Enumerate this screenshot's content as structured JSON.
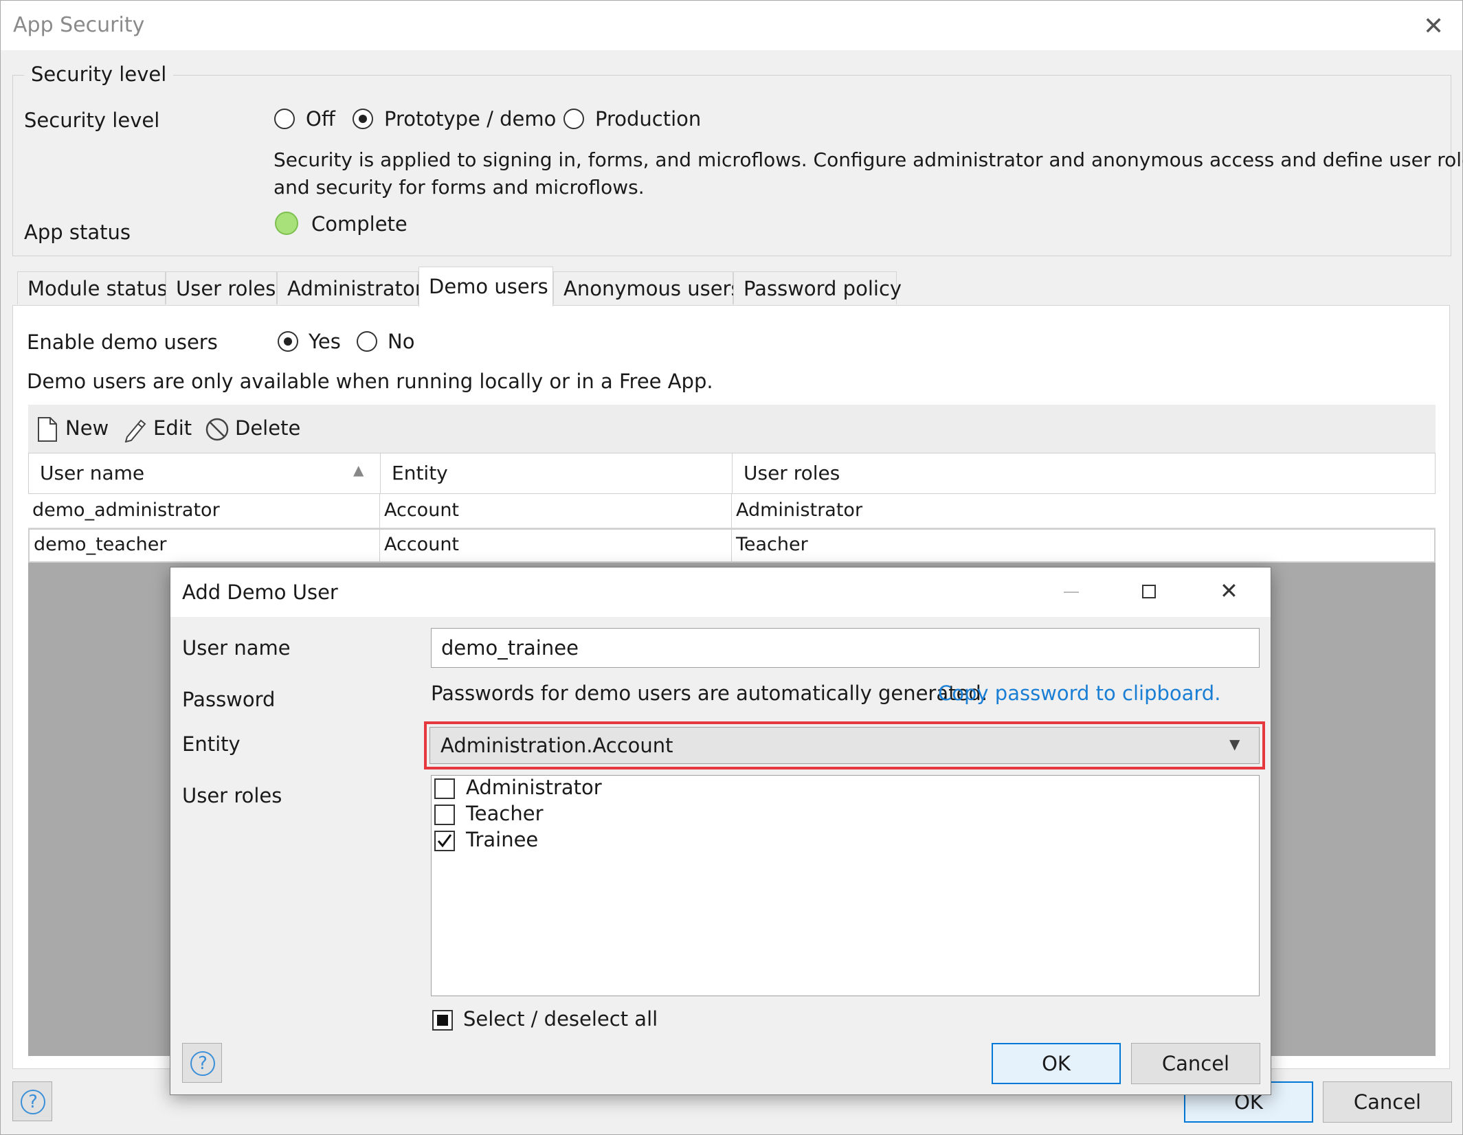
{
  "window": {
    "title": "App Security",
    "ok_label": "OK",
    "cancel_label": "Cancel"
  },
  "security": {
    "group_title": "Security level",
    "level_label": "Security level",
    "options": [
      "Off",
      "Prototype / demo",
      "Production"
    ],
    "selected": "Prototype / demo",
    "description_line1": "Security is applied to signing in, forms, and microflows. Configure administrator and anonymous access and define user roles",
    "description_line2": "and security for forms and microflows.",
    "app_status_label": "App status",
    "app_status_value": "Complete",
    "status_color": "#a8e07a"
  },
  "tabs": [
    "Module status",
    "User roles",
    "Administrator",
    "Demo users",
    "Anonymous users",
    "Password policy"
  ],
  "active_tab": "Demo users",
  "demo_users": {
    "enable_label": "Enable demo users",
    "yes_label": "Yes",
    "no_label": "No",
    "enabled": "Yes",
    "note": "Demo users are only available when running locally or in a Free App.",
    "toolbar": {
      "new_label": "New",
      "edit_label": "Edit",
      "delete_label": "Delete"
    },
    "columns": [
      "User name",
      "Entity",
      "User roles"
    ],
    "rows": [
      {
        "user_name": "demo_administrator",
        "entity": "Account",
        "roles": "Administrator"
      },
      {
        "user_name": "demo_teacher",
        "entity": "Account",
        "roles": "Teacher"
      }
    ]
  },
  "dialog": {
    "title": "Add Demo User",
    "user_name_label": "User name",
    "user_name_value": "demo_trainee",
    "password_label": "Password",
    "password_note": "Passwords for demo users are automatically generated.",
    "copy_link": "Copy password to clipboard.",
    "entity_label": "Entity",
    "entity_value": "Administration.Account",
    "user_roles_label": "User roles",
    "roles": [
      {
        "name": "Administrator",
        "checked": false
      },
      {
        "name": "Teacher",
        "checked": false
      },
      {
        "name": "Trainee",
        "checked": true
      }
    ],
    "select_all_label": "Select / deselect all",
    "ok_label": "OK",
    "cancel_label": "Cancel",
    "highlight_color": "#e5393f",
    "link_color": "#1a7fd4"
  }
}
